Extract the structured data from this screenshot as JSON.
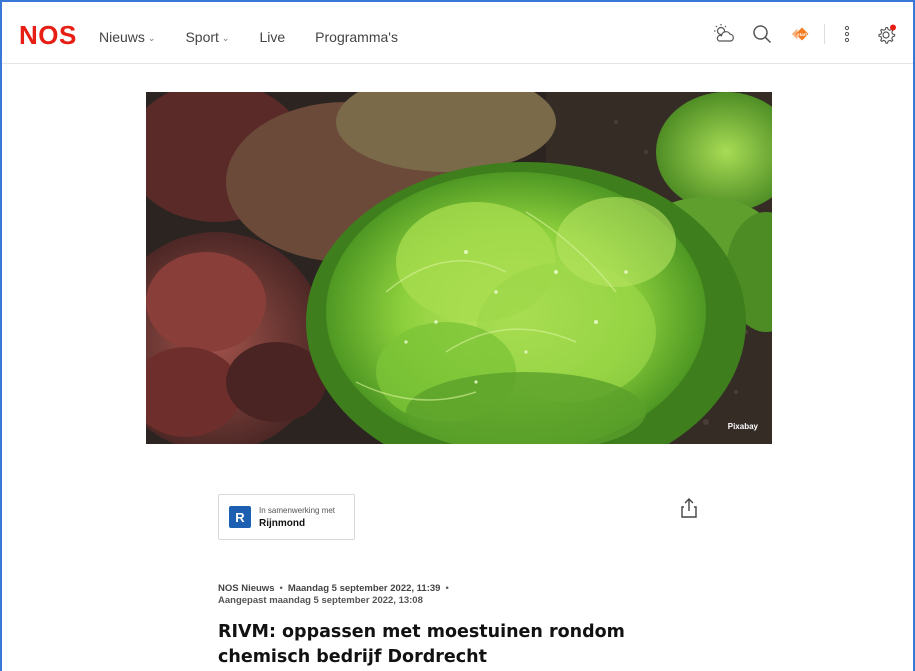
{
  "header": {
    "logo": "NOS",
    "nav": [
      {
        "label": "Nieuws",
        "dropdown": true
      },
      {
        "label": "Sport",
        "dropdown": true
      },
      {
        "label": "Live",
        "dropdown": false
      },
      {
        "label": "Programma's",
        "dropdown": false
      }
    ],
    "icons": [
      "weather-icon",
      "search-icon",
      "npo-start-icon",
      "more-icon",
      "settings-icon"
    ]
  },
  "hero": {
    "credit": "Pixabay"
  },
  "partner": {
    "prefix": "In samenwerking met",
    "name": "Rijnmond",
    "logo_letter": "R"
  },
  "article": {
    "source": "NOS Nieuws",
    "published": "Maandag 5 september 2022, 11:39",
    "updated": "Aangepast maandag 5 september 2022, 13:08",
    "title": "RIVM: oppassen met moestuinen rondom chemisch bedrijf Dordrecht"
  },
  "colors": {
    "brand": "#e61e14",
    "accent": "#1d5fb1",
    "npo": "#f47c20"
  }
}
